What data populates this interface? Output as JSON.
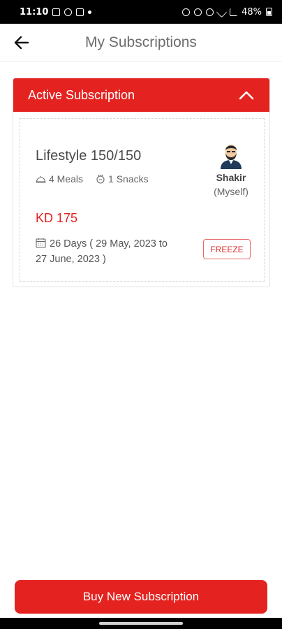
{
  "status_bar": {
    "time": "11:10",
    "battery": "48%"
  },
  "header": {
    "title": "My Subscriptions",
    "back_icon": "arrow-left-icon"
  },
  "panel": {
    "title": "Active Subscription",
    "toggle_icon": "chevron-up-icon",
    "accent_color": "#e42320"
  },
  "subscription": {
    "plan_name": "Lifestyle 150/150",
    "meals": "4 Meals",
    "snacks": "1 Snacks",
    "price": "KD 175",
    "duration_line1": "26 Days ( 29 May, 2023 to",
    "duration_line2": "27 June, 2023 )",
    "person_name": "Shakir",
    "person_relation": "(Myself)",
    "freeze_label": "FREEZE"
  },
  "footer": {
    "buy_label": "Buy New Subscription"
  }
}
